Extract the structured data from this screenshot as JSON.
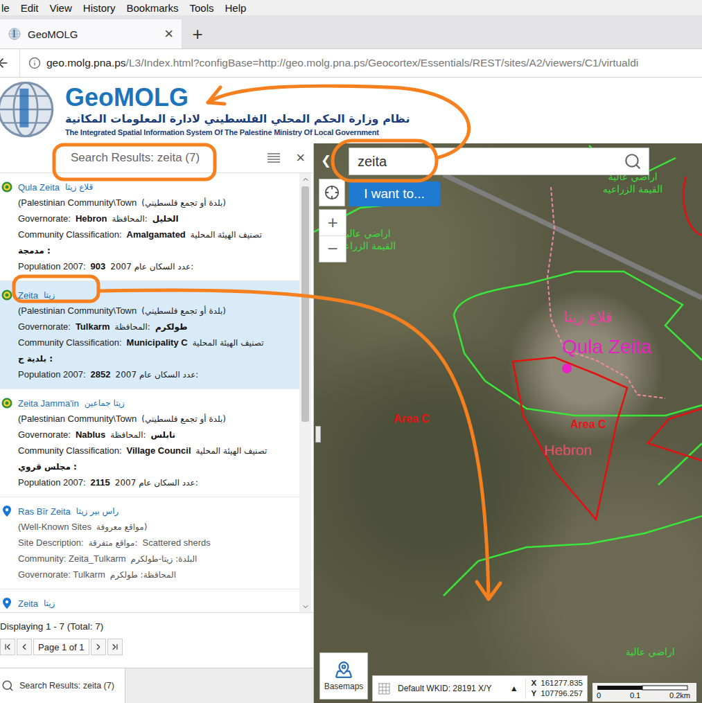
{
  "browser": {
    "menu": [
      "le",
      "Edit",
      "View",
      "History",
      "Bookmarks",
      "Tools",
      "Help"
    ],
    "tab": {
      "title": "GeoMOLG",
      "close": "×",
      "selected": true
    },
    "new_tab": "+",
    "url": {
      "host": "geo.molg.pna.ps",
      "path": "/L3/Index.html?configBase=http://geo.molg.pna.ps/Geocortex/Essentials/REST/sites/A2/viewers/C1/virtualdi"
    }
  },
  "header": {
    "title": "GeoMOLG",
    "subtitle_ar": "نظام وزارة الحكم المحلي الفلسطيني لادارة المعلومات المكانية",
    "subtitle_en": "The Integrated Spatial Information System Of The Palestine Ministry Of Local Government"
  },
  "panel": {
    "title": "Search Results: zeita (7)",
    "close": "×",
    "results": [
      {
        "title": "Qula Zeita",
        "title_ar": "قلاع زيتا",
        "kind": "community",
        "selected": false,
        "lines": [
          [
            {
              "text": "(Palestinian Community\\Town",
              "bold": false
            },
            {
              "text": "(بلدة أو تجمع فلسطيني)",
              "bold": false
            }
          ],
          [
            {
              "text": "Governorate:",
              "bold": false
            },
            {
              "text": "Hebron",
              "bold": true
            },
            {
              "text": "المحافظة:",
              "bold": false
            },
            {
              "text": "الخليل",
              "bold": true
            }
          ],
          [
            {
              "text": "Community Classification:",
              "bold": false
            },
            {
              "text": "Amalgamated",
              "bold": true
            },
            {
              "text": "تصنيف الهيئة المحلية",
              "bold": false
            }
          ],
          [
            {
              "text": "مدمجة :",
              "bold": true
            }
          ],
          [
            {
              "text": "Population 2007:",
              "bold": false
            },
            {
              "text": "903",
              "bold": true
            },
            {
              "text": "عدد السكان عام 2007:",
              "bold": false
            }
          ]
        ]
      },
      {
        "title": "Zeita",
        "title_ar": "زيتا",
        "kind": "community",
        "selected": true,
        "lines": [
          [
            {
              "text": "(Palestinian Community\\Town",
              "bold": false
            },
            {
              "text": "(بلدة أو تجمع فلسطيني)",
              "bold": false
            }
          ],
          [
            {
              "text": "Governorate:",
              "bold": false
            },
            {
              "text": "Tulkarm",
              "bold": true
            },
            {
              "text": "المحافظة:",
              "bold": false
            },
            {
              "text": "طولكرم",
              "bold": true
            }
          ],
          [
            {
              "text": "Community Classification:",
              "bold": false
            },
            {
              "text": "Municipality C",
              "bold": true
            },
            {
              "text": "تصنيف الهيئة المحلية",
              "bold": false
            }
          ],
          [
            {
              "text": "بلدية ج :",
              "bold": true
            }
          ],
          [
            {
              "text": "Population 2007:",
              "bold": false
            },
            {
              "text": "2852",
              "bold": true
            },
            {
              "text": "عدد السكان عام 2007:",
              "bold": false
            }
          ]
        ]
      },
      {
        "title": "Zeita Jamma'in",
        "title_ar": "زيتا جماعين",
        "kind": "community",
        "selected": false,
        "lines": [
          [
            {
              "text": "(Palestinian Community\\Town",
              "bold": false
            },
            {
              "text": "(بلدة أو تجمع فلسطيني)",
              "bold": false
            }
          ],
          [
            {
              "text": "Governorate:",
              "bold": false
            },
            {
              "text": "Nablus",
              "bold": true
            },
            {
              "text": "المحافظة:",
              "bold": false
            },
            {
              "text": "نابلس",
              "bold": true
            }
          ],
          [
            {
              "text": "Community Classification:",
              "bold": false
            },
            {
              "text": "Village Council",
              "bold": true
            },
            {
              "text": "تصنيف الهيئة المحلية",
              "bold": false
            }
          ],
          [
            {
              "text": "مجلس قروي :",
              "bold": true
            }
          ],
          [
            {
              "text": "Population 2007:",
              "bold": false
            },
            {
              "text": "2115",
              "bold": true
            },
            {
              "text": "عدد السكان عام 2007:",
              "bold": false
            }
          ]
        ]
      },
      {
        "title": "Ras Bīr Zeita",
        "title_ar": "راس بير زيتا",
        "kind": "site",
        "selected": false,
        "lines": [
          [
            {
              "text": "(Well-Known Sites",
              "bold": false
            },
            {
              "text": "مواقع معروفة)",
              "bold": false
            }
          ],
          [
            {
              "text": "Site Description:",
              "bold": false
            },
            {
              "text": "مواقع متفرقة:",
              "bold": false
            },
            {
              "text": "Scattered sherds",
              "bold": false
            }
          ],
          [
            {
              "text": "Community: Zeita_Tulkarm",
              "bold": false
            },
            {
              "text": "البلدة: زيتا-طولكرم",
              "bold": false
            }
          ],
          [
            {
              "text": "Governorate: Tulkarm",
              "bold": false
            },
            {
              "text": "المحافظة: طولكرم",
              "bold": false
            }
          ]
        ]
      },
      {
        "title": "Zeita",
        "title_ar": "زيتا",
        "kind": "site",
        "selected": false,
        "lines": []
      }
    ],
    "footer": "Displaying 1 - 7 (Total: 7)",
    "pager": "Page 1 of 1",
    "bottom_tab": {
      "label": "Search Results: zeita (7)",
      "selected": true
    }
  },
  "map": {
    "collapse": "❮",
    "search": {
      "value": "zeita"
    },
    "menu_button": "I want to...",
    "zoom_in": "+",
    "zoom_out": "−",
    "labels": [
      {
        "text": "اراضي عالية القيمة الزراعيه",
        "kind": "landuse",
        "color": "#3fdc3f"
      },
      {
        "text": "اراضي عالية القيمة الزراعيه",
        "kind": "landuse",
        "color": "#3fdc3f"
      },
      {
        "text": "قلاع زيتا",
        "kind": "placear",
        "color": "#ee3fa0"
      },
      {
        "text": "Qula Zeita",
        "kind": "place",
        "color": "#e81fc4"
      },
      {
        "text": "Area C",
        "kind": "area",
        "color": "#e81414"
      },
      {
        "text": "Area C",
        "kind": "area",
        "color": "#e81414"
      },
      {
        "text": "Hebron",
        "kind": "region",
        "color": "#e8506a"
      },
      {
        "text": "اراضي عالية",
        "kind": "landuse",
        "color": "#3fdc3f"
      }
    ],
    "basemaps": "Basemaps",
    "coords": {
      "wkid": "Default WKID: 28191 X/Y",
      "toggle": "▲",
      "x_label": "X",
      "x": "161277.835",
      "y_label": "Y",
      "y": "107796.257"
    },
    "scale": [
      "0",
      "0.1",
      "0.2km"
    ]
  }
}
